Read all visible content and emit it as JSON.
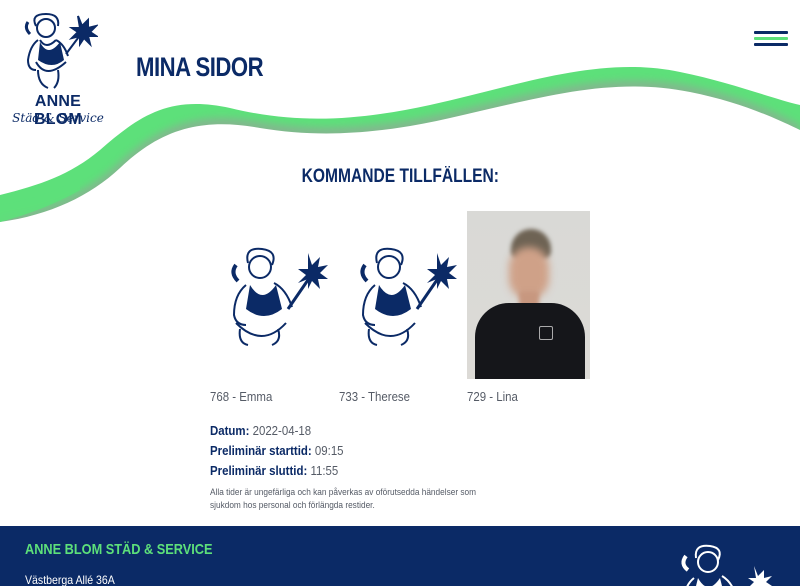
{
  "brand": {
    "name": "ANNE BLOM",
    "tagline": "Städ & Service"
  },
  "header": {
    "title": "MINA SIDOR",
    "menu_icon": "hamburger-menu-icon"
  },
  "upcoming": {
    "heading": "KOMMANDE TILLFÄLLEN:",
    "staff": [
      {
        "label": "768 - Emma",
        "image": "logo-illustration"
      },
      {
        "label": "733 - Therese",
        "image": "logo-illustration"
      },
      {
        "label": "729 - Lina",
        "image": "photo"
      }
    ],
    "date_label": "Datum:",
    "date_value": "2022-04-18",
    "start_label": "Preliminär starttid:",
    "start_value": "09:15",
    "end_label": "Preliminär sluttid:",
    "end_value": "11:55",
    "note": "Alla tider är ungefärliga och kan påverkas av oförutsedda händelser som sjukdom hos personal och förlängda restider."
  },
  "footer": {
    "company": "ANNE BLOM STÄD & SERVICE",
    "address": "Västberga Allé 36A"
  },
  "colors": {
    "navy": "#0b2a66",
    "green": "#5de07a",
    "text_gray": "#555b66"
  }
}
